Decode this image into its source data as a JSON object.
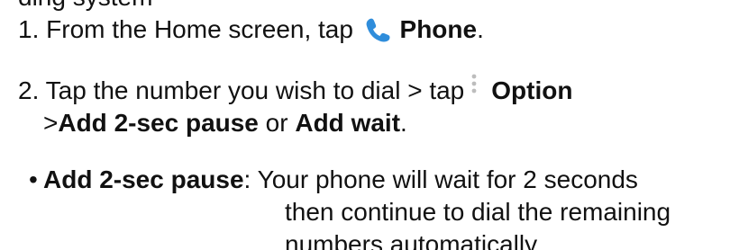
{
  "truncated_top_text": "ding system",
  "steps": [
    {
      "number": "1.",
      "text_before": "From the Home screen, tap",
      "icon": "phone-icon",
      "icon_color": "#2F8DDB",
      "bold_label": "Phone",
      "trailing": "."
    },
    {
      "number": "2.",
      "text_before": "Tap the number you wish to dial > tap",
      "icon": "kebab-menu-icon",
      "icon_color": "#BDBDBD",
      "bold_label": "Option",
      "line2_prefix": ">",
      "line2_bold1": "Add 2-sec pause",
      "line2_mid": " or ",
      "line2_bold2": "Add wait",
      "line2_trailing": "."
    }
  ],
  "bullets": [
    {
      "marker": "•",
      "term": "Add 2-sec pause",
      "separator": ":",
      "desc_line1": "Your phone will wait for 2 seconds",
      "desc_line2": "then continue to dial the remaining",
      "desc_line3": "numbers automatically."
    }
  ]
}
